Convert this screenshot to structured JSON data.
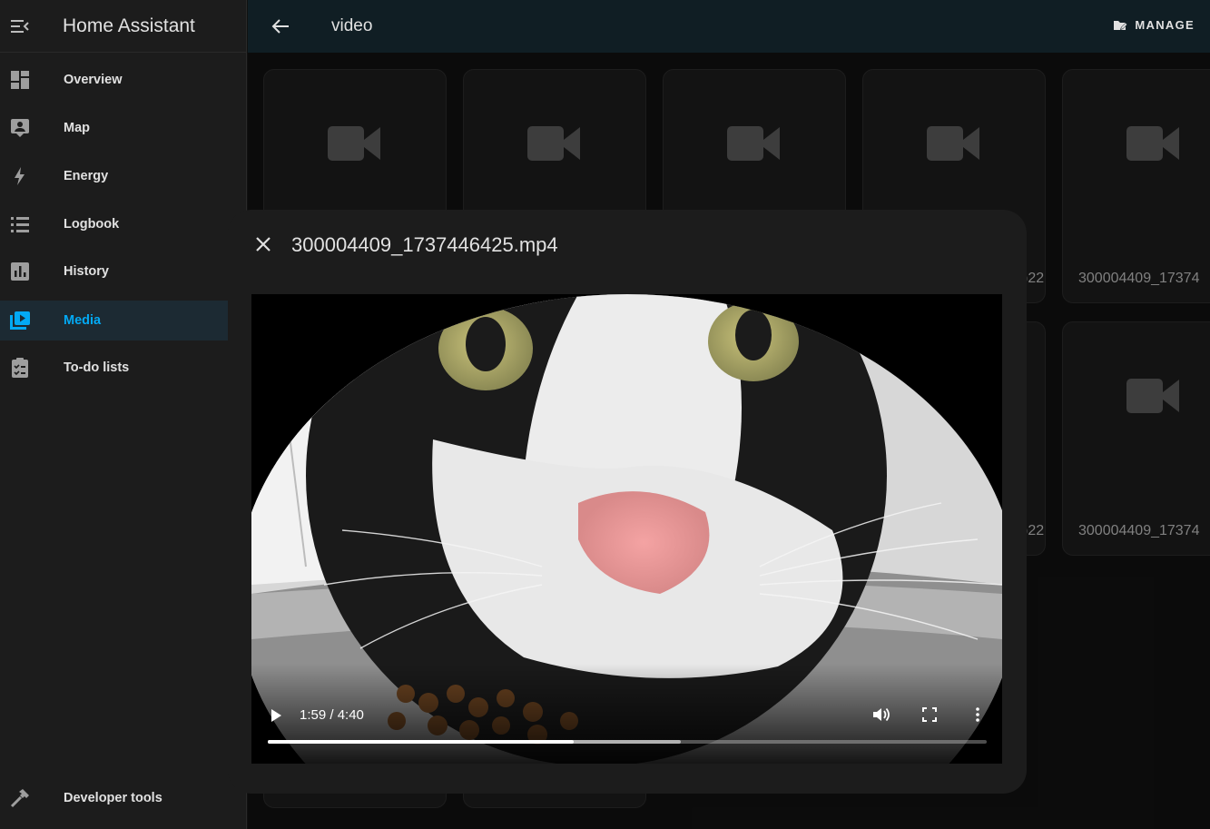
{
  "sidebar": {
    "title": "Home Assistant",
    "items": [
      {
        "label": "Overview",
        "icon": "overview-icon"
      },
      {
        "label": "Map",
        "icon": "map-icon"
      },
      {
        "label": "Energy",
        "icon": "energy-icon"
      },
      {
        "label": "Logbook",
        "icon": "logbook-icon"
      },
      {
        "label": "History",
        "icon": "history-icon"
      },
      {
        "label": "Media",
        "icon": "media-icon",
        "active": true
      },
      {
        "label": "To-do lists",
        "icon": "todo-icon"
      }
    ],
    "bottom_item": {
      "label": "Developer tools",
      "icon": "hammer-icon"
    }
  },
  "topbar": {
    "title": "video",
    "manage_label": "MANAGE"
  },
  "grid": {
    "cards": [
      {
        "caption": ""
      },
      {
        "caption": ""
      },
      {
        "caption": ""
      },
      {
        "caption": ")22"
      },
      {
        "caption": "300004409_17374"
      },
      {
        "caption": ")22"
      },
      {
        "caption": "300004409_17374"
      }
    ]
  },
  "dialog": {
    "title": "300004409_1737446425.mp4",
    "player": {
      "time": "1:59 / 4:40",
      "played_fraction": 0.425,
      "buffered_fraction": 0.575
    }
  },
  "colors": {
    "accent": "#03a9f4",
    "sidebar_bg": "#1c1c1c",
    "topbar_bg": "#101e24",
    "dialog_bg": "#1c1c1c"
  }
}
